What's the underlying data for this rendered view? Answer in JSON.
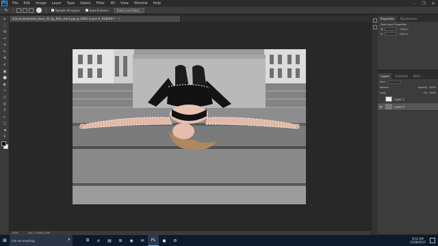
{
  "app": {
    "logo": "Ps"
  },
  "menu": [
    "File",
    "Edit",
    "Image",
    "Layer",
    "Type",
    "Select",
    "Filter",
    "3D",
    "View",
    "Window",
    "Help"
  ],
  "window_controls": [
    "–",
    "❐",
    "✕"
  ],
  "options": {
    "feather_label": "Sample All Layers",
    "auto_enhance_label": "Auto-Enhance",
    "select_mask_label": "Select and Mask..."
  },
  "document": {
    "tab_title": "bilund_bombshell_stock_01_by_fbhs_stock.jpg @ 100% (Layer 0, RGB/8#) *",
    "close": "×",
    "zoom": "100%",
    "doc_size": "Doc: 1.49M/1.10M"
  },
  "tools": [
    "▸",
    "⬚",
    "ʘ",
    "✂",
    "⌗",
    "✎",
    "⊕",
    "✐",
    "▣",
    "⬤",
    "◐",
    "✧",
    "☐",
    "⦿",
    "T",
    "↖",
    "□",
    "☚",
    "⚲"
  ],
  "properties": {
    "tabs": [
      "Properties",
      "Adjustments"
    ],
    "subtitle": "Pixel Layer Properties",
    "fields": [
      {
        "label": "W:",
        "value": "0.00 in"
      },
      {
        "label": "H:",
        "value": "0.00 in"
      }
    ]
  },
  "layers": {
    "tabs": [
      "Layers",
      "Channels",
      "Paths"
    ],
    "blend_mode": "Normal",
    "opacity_label": "Opacity:",
    "opacity_value": "100%",
    "kind_label": "Kind",
    "lock_label": "Lock:",
    "fill_label": "Fill:",
    "fill_value": "100%",
    "items": [
      {
        "name": "Layer 1",
        "visible": false
      },
      {
        "name": "Layer 0",
        "visible": true
      }
    ]
  },
  "taskbar": {
    "start_icon": "windows-logo",
    "search_placeholder": "Ask me anything",
    "time": "8:52 AM",
    "date": "12/28/2015",
    "apps": [
      "⧉",
      "e",
      "▤",
      "⊞",
      "◉",
      "✉",
      "Ps",
      "◼",
      "⚙"
    ]
  },
  "colors": {
    "accent": "#31a8ff",
    "panel": "#3c3c3c",
    "taskbar": "#0d1a2b"
  }
}
